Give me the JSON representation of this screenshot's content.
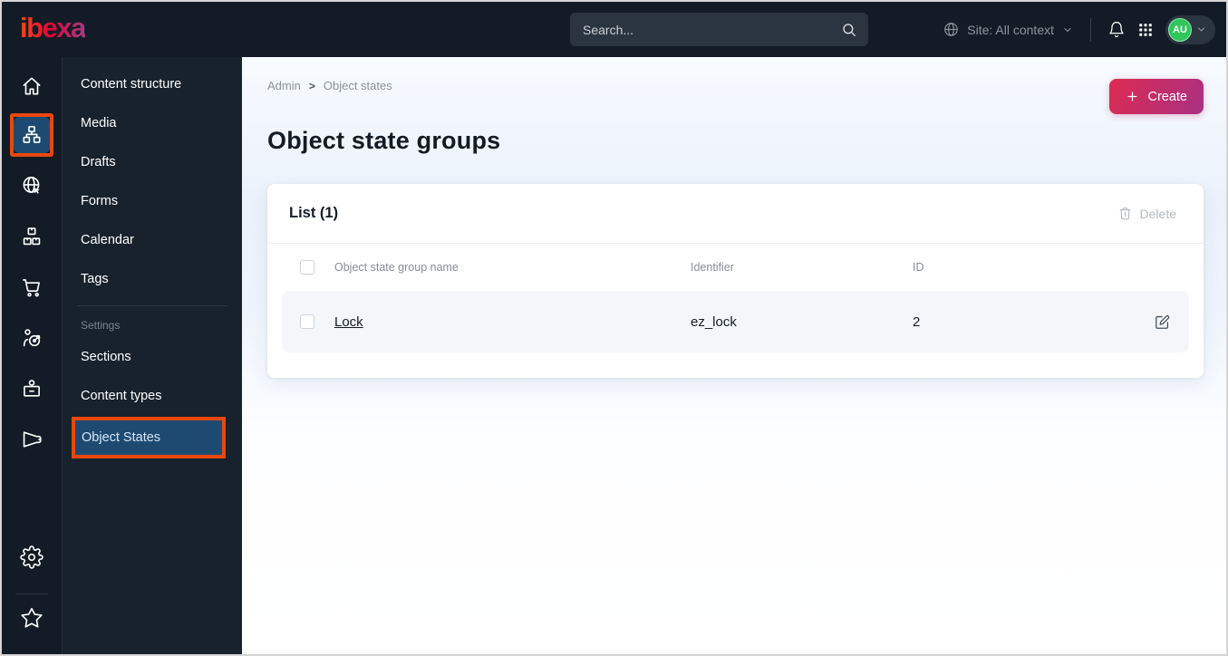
{
  "topbar": {
    "logo": "ibexa",
    "search": {
      "placeholder": "Search..."
    },
    "site_context": "Site: All context",
    "avatar": "AU"
  },
  "rail": {
    "icons": [
      "home-icon",
      "content-structure-icon",
      "site-globe-icon",
      "product-boxes-icon",
      "cart-icon",
      "personalization-target-icon",
      "customer-badge-icon",
      "campaign-megaphone-icon"
    ],
    "bottom_icons": [
      "settings-gear-icon",
      "bookmarks-star-icon"
    ]
  },
  "sidebar": {
    "items": [
      "Content structure",
      "Media",
      "Drafts",
      "Forms",
      "Calendar",
      "Tags"
    ],
    "settings_label": "Settings",
    "settings_items": [
      "Sections",
      "Content types",
      "Object States"
    ]
  },
  "breadcrumb": {
    "items": [
      "Admin",
      "Object states"
    ],
    "separator": ">"
  },
  "page": {
    "title": "Object state groups",
    "create_label": "Create"
  },
  "list_card": {
    "title": "List (1)",
    "delete_label": "Delete",
    "columns": [
      "Object state group name",
      "Identifier",
      "ID"
    ],
    "rows": [
      {
        "name": "Lock",
        "identifier": "ez_lock",
        "id": "2"
      }
    ]
  },
  "colors": {
    "topbar_bg": "#131c26",
    "active_blue": "#1e4a72",
    "annotation_orange": "#e8480e",
    "create_gradient_start": "#dd2b52",
    "create_gradient_end": "#a93083",
    "avatar_green": "#2fc65a",
    "logo_gradient_start": "#ff4713",
    "logo_gradient_end": "#a43a84",
    "row_bg": "#f4f6f9",
    "text_dark": "#131c26",
    "text_muted": "#878d95",
    "disabled": "#b4bac0"
  }
}
